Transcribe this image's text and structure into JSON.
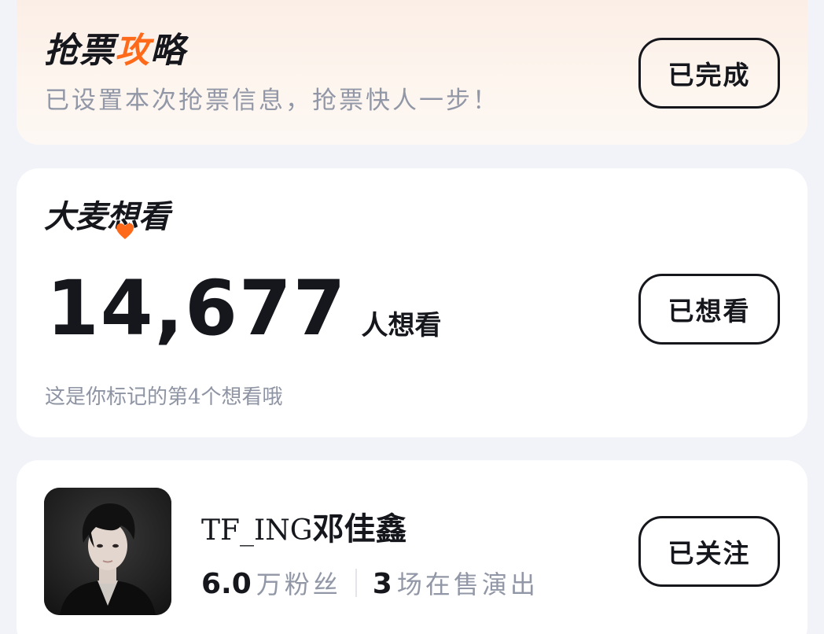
{
  "strategy": {
    "title_part1": "抢票",
    "title_accent": "攻",
    "title_part2": "略",
    "subtitle": "已设置本次抢票信息，抢票快人一步！",
    "button_label": "已完成",
    "accent_color": "#ff6a1a"
  },
  "want": {
    "logo_part1": "大麦",
    "logo_heart_char": "想",
    "logo_part2": "看",
    "count": "14,677",
    "count_unit": "人想看",
    "note": "这是你标记的第4个想看哦",
    "button_label": "已想看"
  },
  "artist": {
    "name_latin": "TF_ING",
    "name_cjk": "邓佳鑫",
    "fans_count": "6.0",
    "fans_label": "万粉丝",
    "shows_count": "3",
    "shows_label": "场在售演出",
    "button_label": "已关注",
    "avatar_icon": "artist-portrait"
  },
  "icons": {
    "heart": "heart-icon"
  }
}
